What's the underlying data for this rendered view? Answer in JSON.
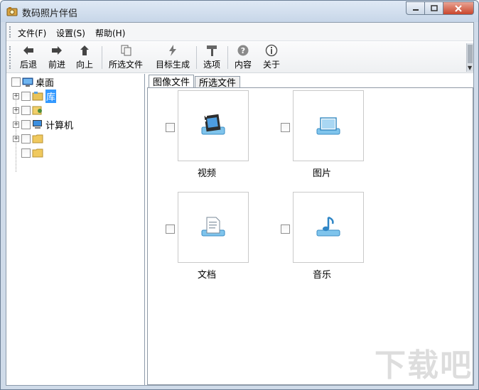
{
  "window": {
    "title": "数码照片伴侣"
  },
  "menu": [
    {
      "label": "文件(F)"
    },
    {
      "label": "设置(S)"
    },
    {
      "label": "帮助(H)"
    }
  ],
  "toolbar": {
    "buttons": [
      {
        "label": "后退",
        "icon": "arrow-left-icon"
      },
      {
        "label": "前进",
        "icon": "arrow-right-icon"
      },
      {
        "label": "向上",
        "icon": "arrow-up-icon"
      },
      {
        "label": "所选文件",
        "icon": "copy-files-icon"
      },
      {
        "label": "目标生成",
        "icon": "lightning-icon"
      },
      {
        "label": "选项",
        "icon": "hammer-icon"
      },
      {
        "label": "内容",
        "icon": "help-icon"
      },
      {
        "label": "关于",
        "icon": "info-icon"
      }
    ]
  },
  "tree": {
    "root": {
      "label": "桌面"
    },
    "items": [
      {
        "label": "库",
        "selected": true
      },
      {
        "label": ""
      },
      {
        "label": "计算机"
      },
      {
        "label": ""
      },
      {
        "label": ""
      }
    ]
  },
  "tabs": [
    {
      "label": "图像文件"
    },
    {
      "label": "所选文件"
    }
  ],
  "categories": [
    {
      "label": "视频",
      "icon": "video-film-icon"
    },
    {
      "label": "图片",
      "icon": "picture-icon"
    },
    {
      "label": "文档",
      "icon": "document-icon"
    },
    {
      "label": "音乐",
      "icon": "music-icon"
    }
  ],
  "watermark": {
    "text": "下载吧"
  },
  "colors": {
    "selection": "#3399ff",
    "accent": "#2f86c6"
  }
}
